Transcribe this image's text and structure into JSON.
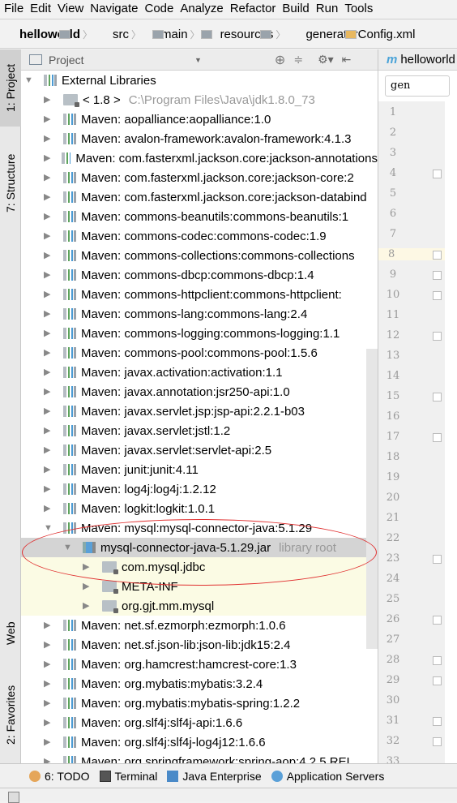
{
  "menu": [
    "File",
    "Edit",
    "View",
    "Navigate",
    "Code",
    "Analyze",
    "Refactor",
    "Build",
    "Run",
    "Tools"
  ],
  "breadcrumb": [
    "helloworld",
    "src",
    "main",
    "resources",
    "generatorConfig.xml"
  ],
  "sidetabs": {
    "project": "1: Project",
    "structure": "7: Structure",
    "web": "Web",
    "favorites": "2: Favorites"
  },
  "panel": {
    "title": "Project"
  },
  "tree": {
    "root": "External Libraries",
    "jdk": {
      "label": "< 1.8 >",
      "path": "C:\\Program Files\\Java\\jdk1.8.0_73"
    },
    "libs_before": [
      "Maven: aopalliance:aopalliance:1.0",
      "Maven: avalon-framework:avalon-framework:4.1.3",
      "Maven: com.fasterxml.jackson.core:jackson-annotations",
      "Maven: com.fasterxml.jackson.core:jackson-core:2",
      "Maven: com.fasterxml.jackson.core:jackson-databind",
      "Maven: commons-beanutils:commons-beanutils:1",
      "Maven: commons-codec:commons-codec:1.9",
      "Maven: commons-collections:commons-collections",
      "Maven: commons-dbcp:commons-dbcp:1.4",
      "Maven: commons-httpclient:commons-httpclient:",
      "Maven: commons-lang:commons-lang:2.4",
      "Maven: commons-logging:commons-logging:1.1",
      "Maven: commons-pool:commons-pool:1.5.6",
      "Maven: javax.activation:activation:1.1",
      "Maven: javax.annotation:jsr250-api:1.0",
      "Maven: javax.servlet.jsp:jsp-api:2.2.1-b03",
      "Maven: javax.servlet:jstl:1.2",
      "Maven: javax.servlet:servlet-api:2.5",
      "Maven: junit:junit:4.11",
      "Maven: log4j:log4j:1.2.12",
      "Maven: logkit:logkit:1.0.1"
    ],
    "mysql": "Maven: mysql:mysql-connector-java:5.1.29",
    "jar": {
      "label": "mysql-connector-java-5.1.29.jar",
      "hint": "library root"
    },
    "packages": [
      "com.mysql.jdbc",
      "META-INF",
      "org.gjt.mm.mysql"
    ],
    "libs_after": [
      "Maven: net.sf.ezmorph:ezmorph:1.0.6",
      "Maven: net.sf.json-lib:json-lib:jdk15:2.4",
      "Maven: org.hamcrest:hamcrest-core:1.3",
      "Maven: org.mybatis:mybatis:3.2.4",
      "Maven: org.mybatis:mybatis-spring:1.2.2",
      "Maven: org.slf4j:slf4j-api:1.6.6",
      "Maven: org.slf4j:slf4j-log4j12:1.6.6",
      "Maven: org.springframework:spring-aop:4.2.5.REL"
    ]
  },
  "editor": {
    "tab": "helloworld",
    "crumb": "gen",
    "lines": [
      "1",
      "2",
      "3",
      "4",
      "5",
      "6",
      "7",
      "8",
      "9",
      "10",
      "11",
      "12",
      "13",
      "14",
      "15",
      "16",
      "17",
      "18",
      "19",
      "20",
      "21",
      "22",
      "23",
      "24",
      "25",
      "26",
      "27",
      "28",
      "29",
      "30",
      "31",
      "32",
      "33"
    ]
  },
  "bottom": {
    "todo": "6: TODO",
    "terminal": "Terminal",
    "java_enterprise": "Java Enterprise",
    "app_servers": "Application Servers"
  },
  "colors": {
    "selection": "#d4d4d4",
    "highlight": "#fbfbe4",
    "annotation": "#e03030"
  }
}
